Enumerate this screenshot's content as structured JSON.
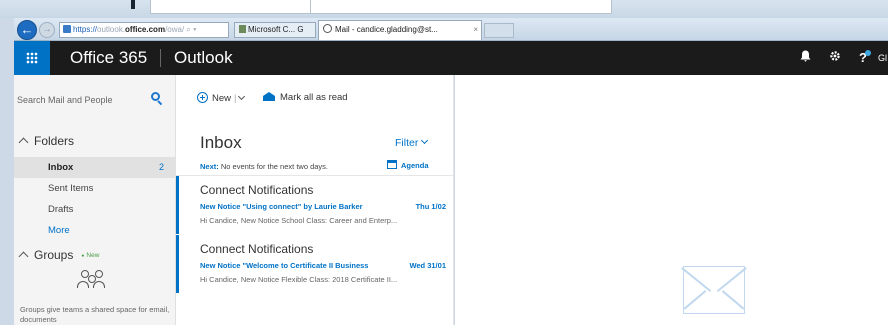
{
  "browser": {
    "url_scheme": "https://",
    "url_domain_gray": "outlook.",
    "url_domain_bold": "office.com",
    "url_path": "/owa/",
    "url_controls": "⌕ ▾",
    "tab1_title": "Microsoft C... G",
    "tab2_title": "Mail - candice.gladding@st...",
    "tab2_close": "×",
    "back_glyph": "←",
    "forward_glyph": "→"
  },
  "header": {
    "brand": "Office 365",
    "app_name": "Outlook",
    "avatar_initial": "Gl",
    "icons": [
      "bell-icon",
      "gear-icon",
      "help-icon"
    ]
  },
  "leftnav": {
    "search_placeholder": "Search Mail and People",
    "folders_label": "Folders",
    "items": [
      {
        "label": "Inbox",
        "count": "2"
      },
      {
        "label": "Sent Items"
      },
      {
        "label": "Drafts"
      },
      {
        "label": "More"
      }
    ],
    "groups_label": "Groups",
    "groups_new_badge": "New",
    "groups_text": "Groups give teams a shared space for email, documents"
  },
  "toolbar": {
    "new_label": "New",
    "new_separator": "|",
    "mark_all_label": "Mark all as read"
  },
  "list": {
    "title": "Inbox",
    "filter_label": "Filter",
    "next_label": "Next:",
    "next_text": "No events for the next two days.",
    "agenda_label": "Agenda",
    "messages": [
      {
        "from": "Connect Notifications",
        "subject": "New Notice \"Using connect\" by Laurie Barker",
        "date": "Thu 1/02",
        "preview": "Hi Candice, New Notice School Class: Career and Enterp..."
      },
      {
        "from": "Connect Notifications",
        "subject": "New Notice \"Welcome to Certificate II Business",
        "date": "Wed 31/01",
        "preview": "Hi Candice, New Notice Flexible Class: 2018 Certificate II..."
      }
    ]
  },
  "colors": {
    "accent": "#0072c6",
    "header_bg": "#1b1b1b",
    "nav_bg": "#f4f4f4"
  }
}
